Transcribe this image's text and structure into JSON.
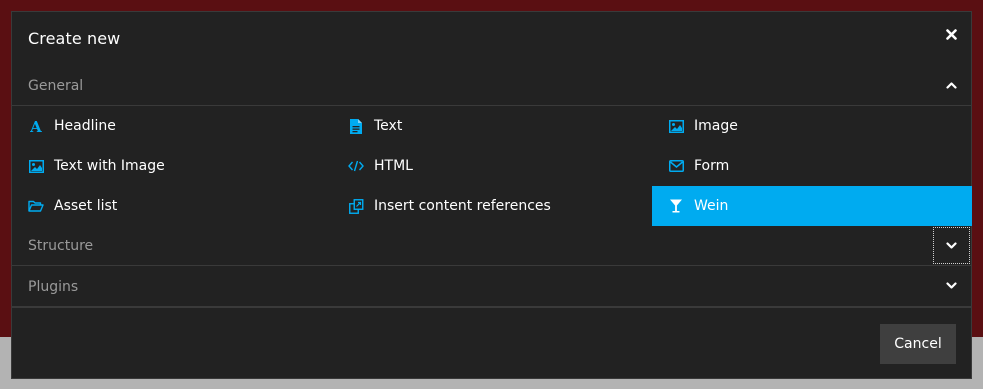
{
  "dialog": {
    "title": "Create new",
    "close_icon": "close-icon",
    "cancel_label": "Cancel"
  },
  "groups": {
    "general": {
      "label": "General",
      "expanded": true,
      "toggle_icon": "chevron-up-icon"
    },
    "structure": {
      "label": "Structure",
      "expanded": false,
      "toggle_icon": "chevron-down-icon"
    },
    "plugins": {
      "label": "Plugins",
      "expanded": false,
      "toggle_icon": "chevron-down-icon"
    }
  },
  "items": [
    {
      "label": "Headline",
      "icon": "headline-icon"
    },
    {
      "label": "Text",
      "icon": "document-icon"
    },
    {
      "label": "Image",
      "icon": "image-icon"
    },
    {
      "label": "Text with Image",
      "icon": "text-with-image-icon"
    },
    {
      "label": "HTML",
      "icon": "code-icon"
    },
    {
      "label": "Form",
      "icon": "envelope-icon"
    },
    {
      "label": "Asset list",
      "icon": "folder-open-icon"
    },
    {
      "label": "Insert content references",
      "icon": "content-references-icon"
    },
    {
      "label": "Wein",
      "icon": "glass-icon",
      "active": true
    }
  ],
  "colors": {
    "accent": "#00abf0",
    "dialog_bg": "#222222",
    "backdrop": "#5a0f12"
  }
}
